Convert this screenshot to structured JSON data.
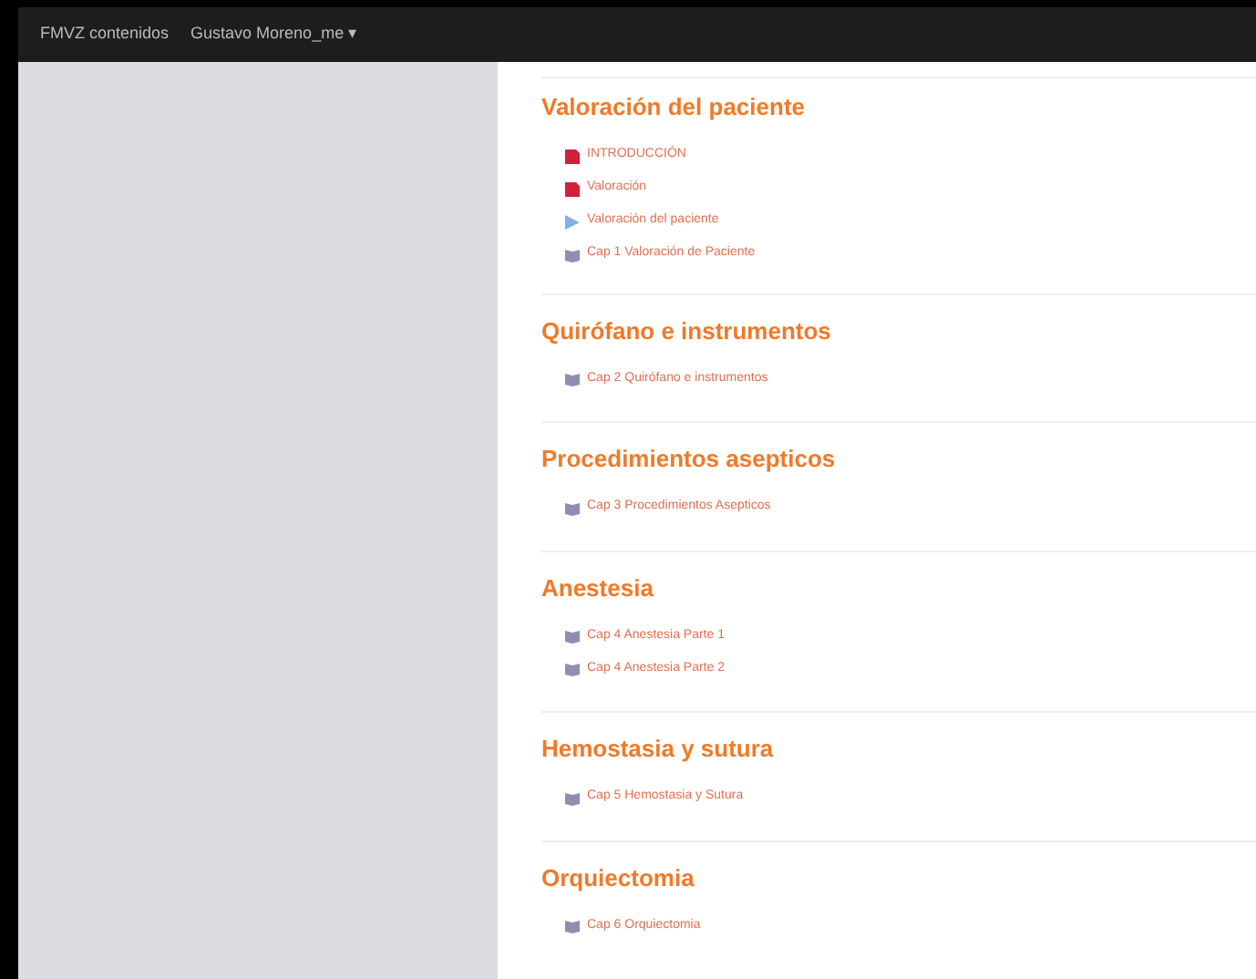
{
  "navbar": {
    "brand": "FMVZ contenidos",
    "user_menu": "Gustavo Moreno_me ▾"
  },
  "sections": [
    {
      "title": "Valoración del paciente",
      "items": [
        {
          "kind": "pdf",
          "label": "INTRODUCCIÓN"
        },
        {
          "kind": "pdf",
          "label": "Valoración"
        },
        {
          "kind": "video",
          "label": "Valoración del paciente"
        },
        {
          "kind": "book",
          "label": "Cap 1 Valoración de Paciente"
        }
      ]
    },
    {
      "title": "Quirófano e instrumentos",
      "items": [
        {
          "kind": "book",
          "label": "Cap 2 Quirófano e instrumentos"
        }
      ]
    },
    {
      "title": "Procedimientos asepticos",
      "items": [
        {
          "kind": "book",
          "label": "Cap 3 Procedimientos Asepticos"
        }
      ]
    },
    {
      "title": "Anestesia",
      "items": [
        {
          "kind": "book",
          "label": "Cap 4 Anestesia Parte 1"
        },
        {
          "kind": "book",
          "label": "Cap 4 Anestesia Parte 2"
        }
      ]
    },
    {
      "title": "Hemostasia y sutura",
      "items": [
        {
          "kind": "book",
          "label": "Cap 5 Hemostasia y Sutura"
        }
      ]
    },
    {
      "title": "Orquiectomia",
      "items": [
        {
          "kind": "book",
          "label": "Cap 6 Orquiectomia"
        }
      ]
    }
  ]
}
